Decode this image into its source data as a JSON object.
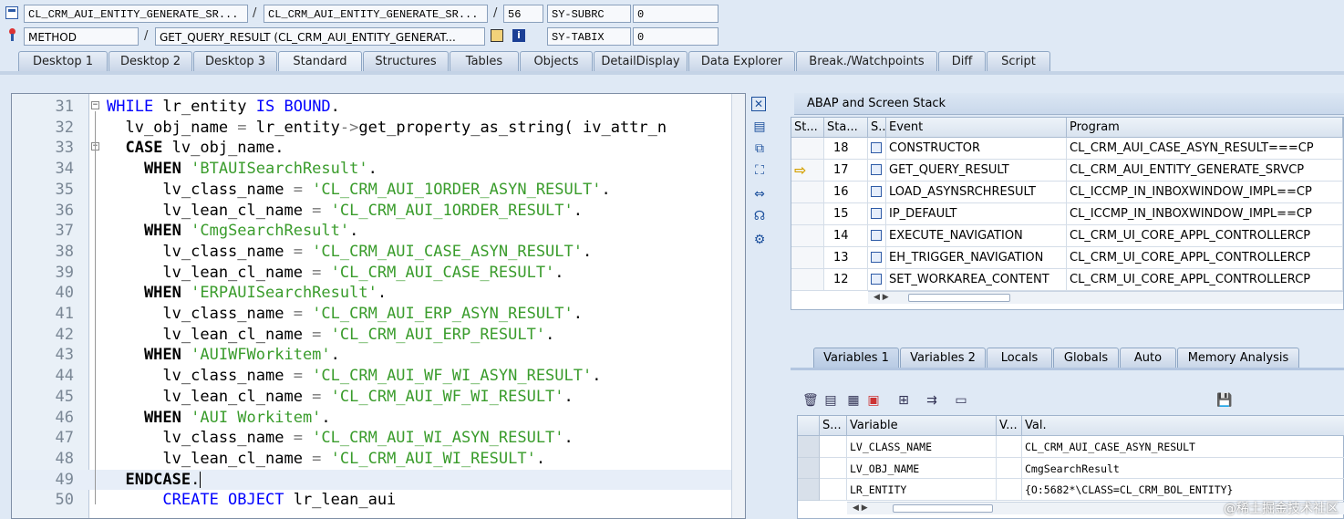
{
  "header": {
    "row1": {
      "program": "CL_CRM_AUI_ENTITY_GENERATE_SR...",
      "include": "CL_CRM_AUI_ENTITY_GENERATE_SR...",
      "line": "56",
      "sysvar_name": "SY-SUBRC",
      "sysvar_value": "0"
    },
    "row2": {
      "type": "METHOD",
      "method": "GET_QUERY_RESULT (CL_CRM_AUI_ENTITY_GENERAT...",
      "sysvar_name": "SY-TABIX",
      "sysvar_value": "0"
    }
  },
  "tabs": [
    "Desktop 1",
    "Desktop 2",
    "Desktop 3",
    "Standard",
    "Structures",
    "Tables",
    "Objects",
    "DetailDisplay",
    "Data Explorer",
    "Break./Watchpoints",
    "Diff",
    "Script"
  ],
  "editor": {
    "lines": [
      {
        "n": "31",
        "parts": [
          {
            "t": "WHILE ",
            "c": "kw"
          },
          {
            "t": "lr_entity ",
            "c": ""
          },
          {
            "t": "IS BOUND",
            "c": "kw"
          },
          {
            "t": ".",
            "c": ""
          }
        ]
      },
      {
        "n": "32",
        "parts": [
          {
            "t": "  lv_obj_name ",
            "c": ""
          },
          {
            "t": "=",
            "c": "ops"
          },
          {
            "t": " lr_entity",
            "c": ""
          },
          {
            "t": "->",
            "c": "ops"
          },
          {
            "t": "get_property_as_string( iv_attr_n",
            "c": ""
          }
        ]
      },
      {
        "n": "33",
        "parts": [
          {
            "t": "  CASE ",
            "c": "kwb"
          },
          {
            "t": "lv_obj_name.",
            "c": ""
          }
        ]
      },
      {
        "n": "34",
        "parts": [
          {
            "t": "    WHEN ",
            "c": "kwb"
          },
          {
            "t": "'BTAUISearchResult'",
            "c": "str"
          },
          {
            "t": ".",
            "c": ""
          }
        ]
      },
      {
        "n": "35",
        "parts": [
          {
            "t": "      lv_class_name ",
            "c": ""
          },
          {
            "t": "=",
            "c": "ops"
          },
          {
            "t": " 'CL_CRM_AUI_1ORDER_ASYN_RESULT'",
            "c": "str"
          },
          {
            "t": ".",
            "c": ""
          }
        ]
      },
      {
        "n": "36",
        "parts": [
          {
            "t": "      lv_lean_cl_name ",
            "c": ""
          },
          {
            "t": "=",
            "c": "ops"
          },
          {
            "t": " 'CL_CRM_AUI_1ORDER_RESULT'",
            "c": "str"
          },
          {
            "t": ".",
            "c": ""
          }
        ]
      },
      {
        "n": "37",
        "parts": [
          {
            "t": "    WHEN ",
            "c": "kwb"
          },
          {
            "t": "'CmgSearchResult'",
            "c": "str"
          },
          {
            "t": ".",
            "c": ""
          }
        ]
      },
      {
        "n": "38",
        "parts": [
          {
            "t": "      lv_class_name ",
            "c": ""
          },
          {
            "t": "=",
            "c": "ops"
          },
          {
            "t": " 'CL_CRM_AUI_CASE_ASYN_RESULT'",
            "c": "str"
          },
          {
            "t": ".",
            "c": ""
          }
        ]
      },
      {
        "n": "39",
        "parts": [
          {
            "t": "      lv_lean_cl_name ",
            "c": ""
          },
          {
            "t": "=",
            "c": "ops"
          },
          {
            "t": " 'CL_CRM_AUI_CASE_RESULT'",
            "c": "str"
          },
          {
            "t": ".",
            "c": ""
          }
        ]
      },
      {
        "n": "40",
        "parts": [
          {
            "t": "    WHEN ",
            "c": "kwb"
          },
          {
            "t": "'ERPAUISearchResult'",
            "c": "str"
          },
          {
            "t": ".",
            "c": ""
          }
        ]
      },
      {
        "n": "41",
        "parts": [
          {
            "t": "      lv_class_name ",
            "c": ""
          },
          {
            "t": "=",
            "c": "ops"
          },
          {
            "t": " 'CL_CRM_AUI_ERP_ASYN_RESULT'",
            "c": "str"
          },
          {
            "t": ".",
            "c": ""
          }
        ]
      },
      {
        "n": "42",
        "parts": [
          {
            "t": "      lv_lean_cl_name ",
            "c": ""
          },
          {
            "t": "=",
            "c": "ops"
          },
          {
            "t": " 'CL_CRM_AUI_ERP_RESULT'",
            "c": "str"
          },
          {
            "t": ".",
            "c": ""
          }
        ]
      },
      {
        "n": "43",
        "parts": [
          {
            "t": "    WHEN ",
            "c": "kwb"
          },
          {
            "t": "'AUIWFWorkitem'",
            "c": "str"
          },
          {
            "t": ".",
            "c": ""
          }
        ]
      },
      {
        "n": "44",
        "parts": [
          {
            "t": "      lv_class_name ",
            "c": ""
          },
          {
            "t": "=",
            "c": "ops"
          },
          {
            "t": " 'CL_CRM_AUI_WF_WI_ASYN_RESULT'",
            "c": "str"
          },
          {
            "t": ".",
            "c": ""
          }
        ]
      },
      {
        "n": "45",
        "parts": [
          {
            "t": "      lv_lean_cl_name ",
            "c": ""
          },
          {
            "t": "=",
            "c": "ops"
          },
          {
            "t": " 'CL_CRM_AUI_WF_WI_RESULT'",
            "c": "str"
          },
          {
            "t": ".",
            "c": ""
          }
        ]
      },
      {
        "n": "46",
        "parts": [
          {
            "t": "    WHEN ",
            "c": "kwb"
          },
          {
            "t": "'AUI Workitem'",
            "c": "str"
          },
          {
            "t": ".",
            "c": ""
          }
        ]
      },
      {
        "n": "47",
        "parts": [
          {
            "t": "      lv_class_name ",
            "c": ""
          },
          {
            "t": "=",
            "c": "ops"
          },
          {
            "t": " 'CL_CRM_AUI_WI_ASYN_RESULT'",
            "c": "str"
          },
          {
            "t": ".",
            "c": ""
          }
        ]
      },
      {
        "n": "48",
        "parts": [
          {
            "t": "      lv_lean_cl_name ",
            "c": ""
          },
          {
            "t": "=",
            "c": "ops"
          },
          {
            "t": " 'CL_CRM_AUI_WI_RESULT'",
            "c": "str"
          },
          {
            "t": ".",
            "c": ""
          }
        ]
      },
      {
        "n": "49",
        "parts": [
          {
            "t": "  ENDCASE",
            "c": "kwb"
          },
          {
            "t": ".",
            "c": ""
          }
        ]
      },
      {
        "n": "50",
        "parts": [
          {
            "t": "      CREATE OBJECT ",
            "c": "kw"
          },
          {
            "t": "lr_lean_aui",
            "c": ""
          }
        ]
      }
    ]
  },
  "stack": {
    "title": "ABAP and Screen Stack",
    "columns": [
      "St...",
      "Sta...",
      "S..",
      "Event",
      "Program"
    ],
    "rows": [
      {
        "level": "18",
        "event": "CONSTRUCTOR",
        "program": "CL_CRM_AUI_CASE_ASYN_RESULT===CP",
        "current": false
      },
      {
        "level": "17",
        "event": "GET_QUERY_RESULT",
        "program": "CL_CRM_AUI_ENTITY_GENERATE_SRVCP",
        "current": true
      },
      {
        "level": "16",
        "event": "LOAD_ASYNSRCHRESULT",
        "program": "CL_ICCMP_IN_INBOXWINDOW_IMPL==CP",
        "current": false
      },
      {
        "level": "15",
        "event": "IP_DEFAULT",
        "program": "CL_ICCMP_IN_INBOXWINDOW_IMPL==CP",
        "current": false
      },
      {
        "level": "14",
        "event": "EXECUTE_NAVIGATION",
        "program": "CL_CRM_UI_CORE_APPL_CONTROLLERCP",
        "current": false
      },
      {
        "level": "13",
        "event": "EH_TRIGGER_NAVIGATION",
        "program": "CL_CRM_UI_CORE_APPL_CONTROLLERCP",
        "current": false
      },
      {
        "level": "12",
        "event": "SET_WORKAREA_CONTENT",
        "program": "CL_CRM_UI_CORE_APPL_CONTROLLERCP",
        "current": false
      }
    ]
  },
  "variables": {
    "tabs": [
      "Variables 1",
      "Variables 2",
      "Locals",
      "Globals",
      "Auto",
      "Memory Analysis"
    ],
    "columns": [
      "S...",
      "Variable",
      "V...",
      "Val."
    ],
    "rows": [
      {
        "name": "LV_CLASS_NAME",
        "value": "CL_CRM_AUI_CASE_ASYN_RESULT"
      },
      {
        "name": "LV_OBJ_NAME",
        "value": "CmgSearchResult"
      },
      {
        "name": "LR_ENTITY",
        "value": "{O:5682*\\CLASS=CL_CRM_BOL_ENTITY}"
      }
    ]
  },
  "watermark": "@稀土掘金技术社区",
  "colors": {
    "keyword": "#0000ff",
    "string": "#3a9c2c",
    "background": "#dfe9f5"
  }
}
